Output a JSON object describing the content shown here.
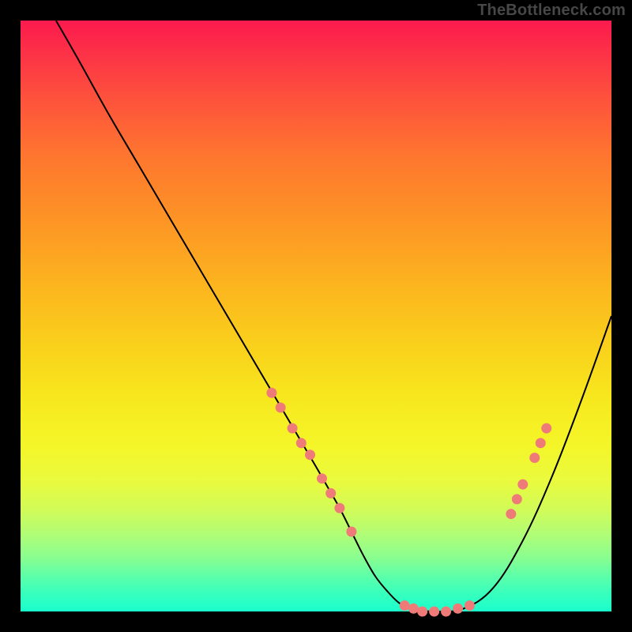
{
  "watermark": "TheBottleneck.com",
  "chart_data": {
    "type": "line",
    "title": "",
    "xlabel": "",
    "ylabel": "",
    "xlim": [
      0,
      100
    ],
    "ylim": [
      0,
      100
    ],
    "grid": false,
    "series": [
      {
        "name": "curve",
        "color": "#000000",
        "stroke_width": 2,
        "x": [
          6,
          10,
          15,
          20,
          25,
          30,
          35,
          40,
          45,
          50,
          52,
          54,
          56,
          58,
          60,
          62,
          64,
          66,
          70,
          75,
          80,
          85,
          90,
          95,
          100
        ],
        "y": [
          100,
          93,
          84,
          75.5,
          67,
          58.5,
          50,
          41.5,
          33,
          24.5,
          21,
          17.5,
          13.5,
          9.5,
          6,
          3.5,
          1.5,
          0.5,
          0,
          0.5,
          4,
          12,
          23,
          36,
          50
        ]
      }
    ],
    "markers": {
      "shape": "circle",
      "color": "#ef7b79",
      "radius": 6.5,
      "points": [
        {
          "x": 42.5,
          "y": 37
        },
        {
          "x": 44,
          "y": 34.5
        },
        {
          "x": 46,
          "y": 31
        },
        {
          "x": 47.5,
          "y": 28.5
        },
        {
          "x": 49,
          "y": 26.5
        },
        {
          "x": 51,
          "y": 22.5
        },
        {
          "x": 52.5,
          "y": 20
        },
        {
          "x": 54,
          "y": 17.5
        },
        {
          "x": 56,
          "y": 13.5
        },
        {
          "x": 65,
          "y": 1
        },
        {
          "x": 66.5,
          "y": 0.5
        },
        {
          "x": 68,
          "y": 0
        },
        {
          "x": 70,
          "y": 0
        },
        {
          "x": 72,
          "y": 0
        },
        {
          "x": 74,
          "y": 0.5
        },
        {
          "x": 76,
          "y": 1
        },
        {
          "x": 83,
          "y": 16.5
        },
        {
          "x": 84,
          "y": 19
        },
        {
          "x": 85,
          "y": 21.5
        },
        {
          "x": 87,
          "y": 26
        },
        {
          "x": 88,
          "y": 28.5
        },
        {
          "x": 89,
          "y": 31
        }
      ]
    }
  }
}
